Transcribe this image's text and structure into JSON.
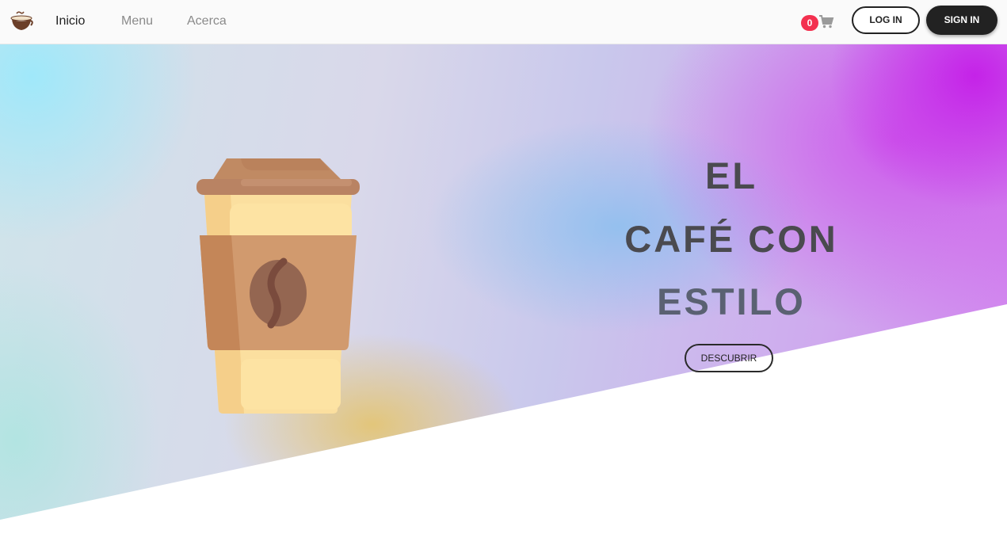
{
  "nav": {
    "logo_icon": "coffee-cup-logo-icon",
    "links": [
      {
        "label": "Inicio",
        "active": true
      },
      {
        "label": "Menu",
        "active": false
      },
      {
        "label": "Acerca",
        "active": false
      }
    ],
    "cart_count": "0",
    "cart_icon": "shopping-cart-icon",
    "login_label": "LOG IN",
    "signin_label": "SIGN IN"
  },
  "hero": {
    "headline": [
      "EL",
      "CAFÉ CON",
      "ESTILO"
    ],
    "cta_label": "DESCUBRIR",
    "illustration": "takeaway-coffee-cup-icon"
  },
  "colors": {
    "badge": "#f3304f",
    "dark": "#222222",
    "headline": "#4a4a4f",
    "gradient_magenta": "#c41ee8",
    "gradient_cyan": "#a0e8fa",
    "gradient_gold": "#e4c46e"
  }
}
